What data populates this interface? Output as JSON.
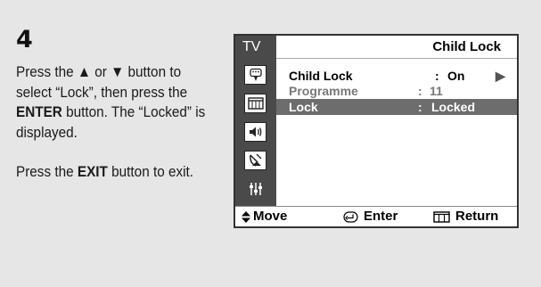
{
  "step": {
    "number": "4"
  },
  "instructions": {
    "p1_a": "Press the ",
    "p1_up": "▲",
    "p1_or": " or ",
    "p1_down": "▼",
    "p1_b": " button to select “Lock”, then press the ",
    "p1_enter": "ENTER",
    "p1_c": " button. The “Locked” is displayed.",
    "p2_a": "Press the ",
    "p2_exit": "EXIT",
    "p2_b": " button to exit."
  },
  "osd": {
    "source": "TV",
    "title": "Child Lock",
    "rows": [
      {
        "label": "Child Lock",
        "sep": ":",
        "value": "On",
        "arrow": "▶"
      },
      {
        "label": "Programme",
        "sep": ":",
        "value": "11"
      },
      {
        "label": "Lock",
        "sep": ":",
        "value": "Locked"
      }
    ],
    "sidebar_icons": [
      "picture-icon",
      "channel-icon",
      "sound-icon",
      "antenna-icon",
      "setup-icon"
    ],
    "footer": {
      "move_label": "Move",
      "enter_label": "Enter",
      "return_label": "Return"
    }
  },
  "colors": {
    "background": "#e6e6e6",
    "osd_dark": "#4a4a4a",
    "highlight": "#6d6d6d"
  }
}
